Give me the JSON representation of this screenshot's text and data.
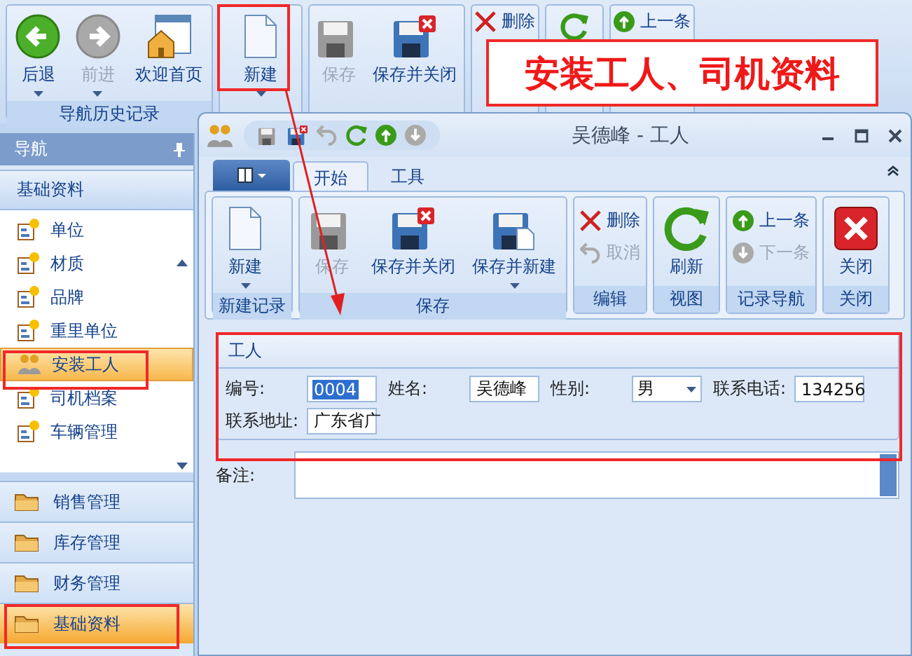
{
  "main_ribbon": {
    "groups": [
      {
        "label": "导航历史记录",
        "buttons": [
          {
            "label": "后退",
            "kind": "large",
            "disabled": false,
            "dropdown": true
          },
          {
            "label": "前进",
            "kind": "large",
            "disabled": true,
            "dropdown": true
          },
          {
            "label": "欢迎首页",
            "kind": "large",
            "disabled": false,
            "dropdown": false
          }
        ]
      },
      {
        "buttons": [
          {
            "label": "新建",
            "kind": "large",
            "disabled": false,
            "dropdown": true
          }
        ]
      },
      {
        "buttons": [
          {
            "label": "保存",
            "kind": "large",
            "disabled": true,
            "dropdown": false
          },
          {
            "label": "保存并关闭",
            "kind": "large",
            "disabled": false,
            "dropdown": false
          }
        ]
      },
      {
        "buttons": [
          {
            "label": "删除",
            "kind": "small",
            "disabled": false
          }
        ]
      },
      {
        "buttons": [
          {
            "kind": "icon"
          }
        ]
      },
      {
        "buttons": [
          {
            "label": "上一条",
            "kind": "small",
            "disabled": false
          }
        ]
      }
    ]
  },
  "sidebar": {
    "title": "导航",
    "section": "基础资料",
    "items": [
      {
        "label": "单位",
        "kind": "document",
        "selected": false
      },
      {
        "label": "材质",
        "kind": "document",
        "selected": false
      },
      {
        "label": "品牌",
        "kind": "document",
        "selected": false
      },
      {
        "label": "重里单位",
        "kind": "document",
        "selected": false
      },
      {
        "label": "安装工人",
        "kind": "people",
        "selected": true
      },
      {
        "label": "司机档案",
        "kind": "document",
        "selected": false
      },
      {
        "label": "车辆管理",
        "kind": "document",
        "selected": false
      }
    ],
    "groups": [
      {
        "label": "销售管理",
        "selected": false
      },
      {
        "label": "库存管理",
        "selected": false
      },
      {
        "label": "财务管理",
        "selected": false
      },
      {
        "label": "基础资料",
        "selected": true
      }
    ]
  },
  "window": {
    "title": "吴德峰 - 工人",
    "tabs": [
      {
        "label": "开始",
        "selected": true
      },
      {
        "label": "工具",
        "selected": false
      }
    ],
    "groups": [
      {
        "label": "新建记录",
        "buttons": [
          {
            "label": "新建",
            "kind": "large",
            "disabled": false,
            "dropdown": true
          }
        ]
      },
      {
        "label": "保存",
        "buttons": [
          {
            "label": "保存",
            "kind": "large",
            "disabled": true,
            "dropdown": false
          },
          {
            "label": "保存并关闭",
            "kind": "large",
            "disabled": false,
            "dropdown": false
          },
          {
            "label": "保存并新建",
            "kind": "large",
            "disabled": false,
            "dropdown": true
          }
        ]
      },
      {
        "label": "编辑",
        "buttons": [
          {
            "label": "删除",
            "kind": "small",
            "disabled": false
          },
          {
            "label": "取消",
            "kind": "small",
            "disabled": true
          }
        ]
      },
      {
        "label": "视图",
        "buttons": [
          {
            "label": "刷新",
            "kind": "large",
            "disabled": false,
            "dropdown": false
          }
        ]
      },
      {
        "label": "记录导航",
        "buttons": [
          {
            "label": "上一条",
            "kind": "small",
            "disabled": false
          },
          {
            "label": "下一条",
            "kind": "small",
            "disabled": true
          }
        ]
      },
      {
        "label": "关闭",
        "buttons": [
          {
            "label": "关闭",
            "kind": "large",
            "disabled": false,
            "dropdown": false
          }
        ]
      }
    ],
    "form": {
      "title": "工人",
      "fields": [
        {
          "label": "编号:",
          "value": "0004",
          "kind": "text",
          "text_selected": true
        },
        {
          "label": "姓名:",
          "value": "吴德峰",
          "kind": "text",
          "text_selected": false
        },
        {
          "label": "性别:",
          "value": "男",
          "kind": "combo"
        },
        {
          "label": "联系电话:",
          "value": "134256",
          "kind": "text",
          "text_selected": false
        },
        {
          "label": "联系地址:",
          "value": "广东省广",
          "kind": "text",
          "text_selected": false
        }
      ],
      "notes_label": "备注:"
    }
  },
  "annotation": {
    "banner": "安装工人、司机资料"
  }
}
